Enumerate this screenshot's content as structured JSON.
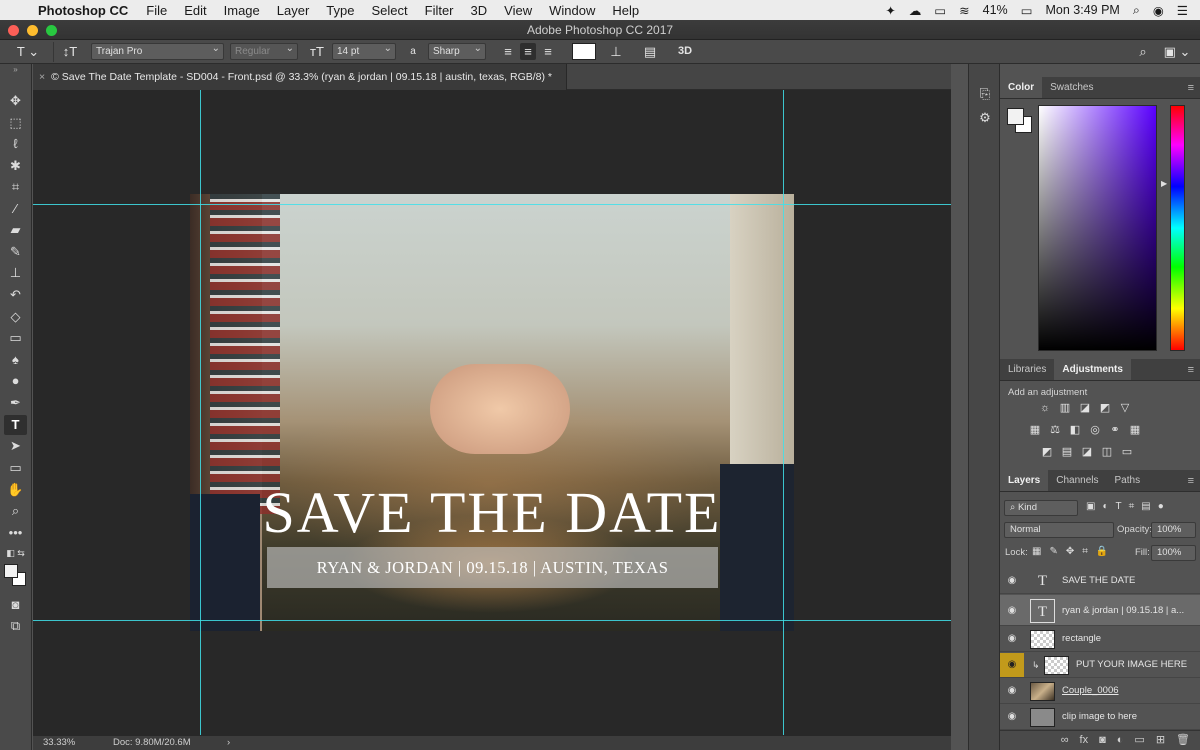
{
  "menubar": {
    "app": "Photoshop CC",
    "menus": [
      "File",
      "Edit",
      "Image",
      "Layer",
      "Type",
      "Select",
      "Filter",
      "3D",
      "View",
      "Window",
      "Help"
    ],
    "battery": "41%",
    "clock": "Mon 3:49 PM"
  },
  "window": {
    "title": "Adobe Photoshop CC 2017"
  },
  "options": {
    "font_family": "Trajan Pro",
    "font_style": "Regular",
    "font_size": "14 pt",
    "antialias_glyph": "a",
    "antialias": "Sharp"
  },
  "document": {
    "tab_title": "© Save The Date Template - SD004 - Front.psd @ 33.3% (ryan & jordan | 09.15.18 | austin, texas, RGB/8) *",
    "headline": "SAVE THE DATE",
    "subline": "RYAN & JORDAN | 09.15.18 | AUSTIN, TEXAS"
  },
  "status": {
    "zoom": "33.33%",
    "doc": "Doc: 9.80M/20.6M"
  },
  "color_panel": {
    "tabs": [
      "Color",
      "Swatches"
    ],
    "foreground": "#f2f2f2",
    "background": "#ffffff"
  },
  "adjustments_panel": {
    "tabs": [
      "Libraries",
      "Adjustments"
    ],
    "heading": "Add an adjustment"
  },
  "layers_panel": {
    "tabs": [
      "Layers",
      "Channels",
      "Paths"
    ],
    "filter": "Kind",
    "blend_mode": "Normal",
    "opacity_label": "Opacity:",
    "opacity": "100%",
    "lock_label": "Lock:",
    "fill_label": "Fill:",
    "fill": "100%",
    "layers": [
      {
        "name": "SAVE THE DATE",
        "type": "text"
      },
      {
        "name": "ryan & jordan | 09.15.18 | a...",
        "type": "text",
        "selected": true
      },
      {
        "name": "rectangle",
        "type": "shape"
      },
      {
        "name": "PUT YOUR IMAGE HERE",
        "type": "smart",
        "clipped": true
      },
      {
        "name": "Couple_0006",
        "type": "image"
      },
      {
        "name": "clip image to here",
        "type": "fill"
      }
    ]
  },
  "colors": {
    "guide": "#3fe0ea",
    "visibility_highlight": "#c29a1b"
  }
}
